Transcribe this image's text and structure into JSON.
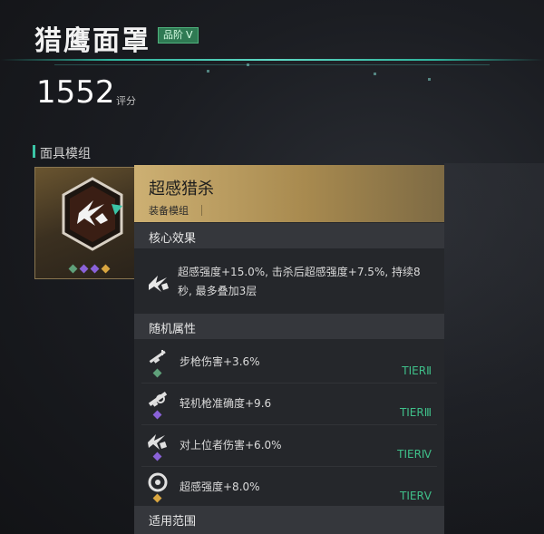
{
  "header": {
    "item_name": "猎鹰面罩",
    "grade_label": "品阶",
    "grade_value": "V",
    "score": "1552",
    "score_label": "评分"
  },
  "modules": {
    "section_label": "面具模组",
    "gem_colors": [
      "#5fa07a",
      "#8a62d8",
      "#8a62d8",
      "#d9a640"
    ]
  },
  "tooltip": {
    "skill_name": "超感猎杀",
    "skill_type": "装备模组",
    "core_title": "核心效果",
    "core_text": "超感强度+15.0%, 击杀后超感强度+7.5%, 持续8秒, 最多叠加3层",
    "random_title": "随机属性",
    "attributes": [
      {
        "text": "步枪伤害+3.6%",
        "tier": "TIERⅡ",
        "tier_color": "#3fc08a",
        "icon": "rifle-icon",
        "gem_color": "#5fa07a"
      },
      {
        "text": "轻机枪准确度+9.6",
        "tier": "TIERⅢ",
        "tier_color": "#3fc08a",
        "icon": "lmg-icon",
        "gem_color": "#8a62d8"
      },
      {
        "text": "对上位者伤害+6.0%",
        "tier": "TIERⅣ",
        "tier_color": "#3fc08a",
        "icon": "shuriken-icon",
        "gem_color": "#8a62d8"
      },
      {
        "text": "超感强度+8.0%",
        "tier": "TIERⅤ",
        "tier_color": "#3fc08a",
        "icon": "swirl-icon",
        "gem_color": "#d9a640"
      }
    ],
    "scope_title": "适用范围"
  }
}
